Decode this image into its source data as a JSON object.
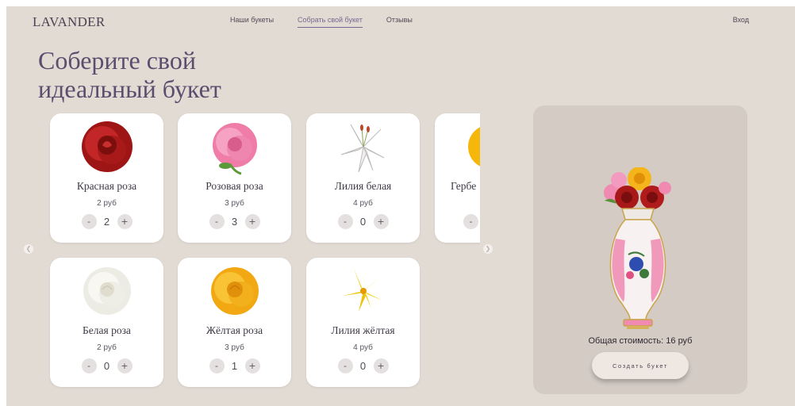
{
  "header": {
    "logo": "LAVANDER",
    "nav": [
      {
        "label": "Наши букеты",
        "active": false
      },
      {
        "label": "Собрать свой букет",
        "active": true
      },
      {
        "label": "Отзывы",
        "active": false
      }
    ],
    "login": "Вход"
  },
  "title_line1": "Соберите свой",
  "title_line2": "идеальный букет",
  "catalog": {
    "prev_icon": "chevron-left-icon",
    "next_icon": "chevron-right-icon",
    "items": [
      {
        "name": "Красная роза",
        "price": "2 руб",
        "qty": "2",
        "color": "#b01c1c",
        "icon": "red-rose-icon"
      },
      {
        "name": "Розовая роза",
        "price": "3 руб",
        "qty": "3",
        "color": "#f28bb0",
        "icon": "pink-rose-icon"
      },
      {
        "name": "Лилия белая",
        "price": "4 руб",
        "qty": "0",
        "color": "#f4f2f2",
        "icon": "white-lily-icon"
      },
      {
        "name": "Гербе",
        "price": "",
        "qty": "",
        "color": "#f5b70a",
        "icon": "gerbera-icon"
      },
      {
        "name": "Белая роза",
        "price": "2 руб",
        "qty": "0",
        "color": "#f6f4ee",
        "icon": "white-rose-icon"
      },
      {
        "name": "Жёлтая роза",
        "price": "3 руб",
        "qty": "1",
        "color": "#f4b81c",
        "icon": "yellow-rose-icon"
      },
      {
        "name": "Лилия жёлтая",
        "price": "4 руб",
        "qty": "0",
        "color": "#f5cf12",
        "icon": "yellow-lily-icon"
      }
    ],
    "minus": "-",
    "plus": "+"
  },
  "preview": {
    "total_label": "Общая стоимость: 16 руб",
    "button_label": "Создать букет",
    "vase_icon": "bouquet-vase-icon"
  }
}
